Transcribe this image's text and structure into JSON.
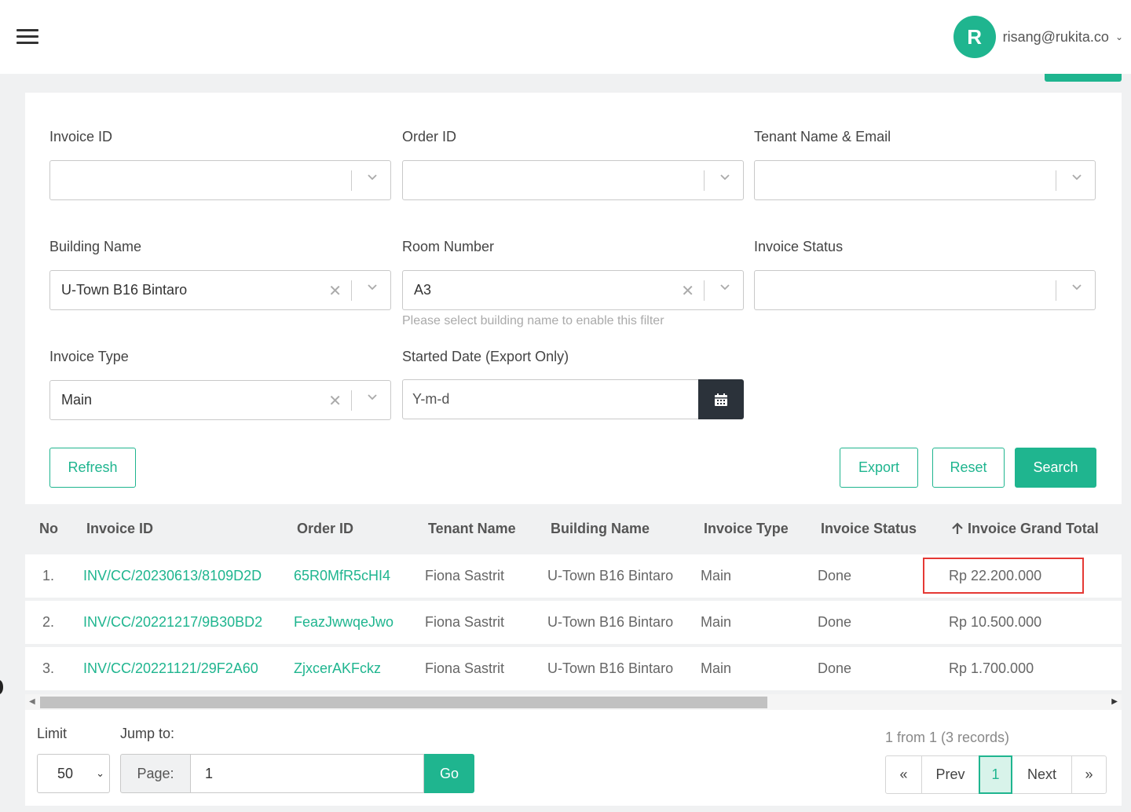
{
  "header": {
    "avatar_initial": "R",
    "user_email": "risang@rukita.co",
    "brand_color": "#1fb58f"
  },
  "filters": {
    "invoice_id": {
      "label": "Invoice ID",
      "value": ""
    },
    "order_id": {
      "label": "Order ID",
      "value": ""
    },
    "tenant": {
      "label": "Tenant Name & Email",
      "value": ""
    },
    "building": {
      "label": "Building Name",
      "value": "U-Town B16 Bintaro"
    },
    "room": {
      "label": "Room Number",
      "value": "A3",
      "hint": "Please select building name to enable this filter"
    },
    "status": {
      "label": "Invoice Status",
      "value": ""
    },
    "type": {
      "label": "Invoice Type",
      "value": "Main"
    },
    "date": {
      "label": "Started Date (Export Only)",
      "placeholder": "Y-m-d"
    }
  },
  "actions": {
    "refresh": "Refresh",
    "export": "Export",
    "reset": "Reset",
    "search": "Search"
  },
  "table": {
    "columns": {
      "no": "No",
      "invoice_id": "Invoice ID",
      "order_id": "Order ID",
      "tenant": "Tenant Name",
      "building": "Building Name",
      "type": "Invoice Type",
      "status": "Invoice Status",
      "total": "Invoice Grand Total",
      "total_sort_icon": "arrow-up-icon"
    },
    "rows": [
      {
        "no": "1.",
        "invoice_id": "INV/CC/20230613/8109D2D",
        "order_id": "65R0MfR5cHI4",
        "tenant": "Fiona Sastrit",
        "building": "U-Town B16 Bintaro",
        "type": "Main",
        "status": "Done",
        "total": "Rp 22.200.000"
      },
      {
        "no": "2.",
        "invoice_id": "INV/CC/20221217/9B30BD2",
        "order_id": "FeazJwwqeJwo",
        "tenant": "Fiona Sastrit",
        "building": "U-Town B16 Bintaro",
        "type": "Main",
        "status": "Done",
        "total": "Rp 10.500.000"
      },
      {
        "no": "3.",
        "invoice_id": "INV/CC/20221121/29F2A60",
        "order_id": "ZjxcerAKFckz",
        "tenant": "Fiona Sastrit",
        "building": "U-Town B16 Bintaro",
        "type": "Main",
        "status": "Done",
        "total": "Rp 1.700.000"
      }
    ]
  },
  "footer": {
    "limit_label": "Limit",
    "limit_value": "50",
    "jump_label": "Jump to:",
    "page_label": "Page:",
    "page_value": "1",
    "go": "Go",
    "records": "1 from 1 (3 records)",
    "first": "«",
    "prev": "Prev",
    "current": "1",
    "next": "Next",
    "last": "»"
  }
}
